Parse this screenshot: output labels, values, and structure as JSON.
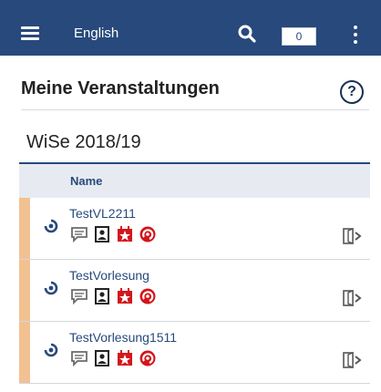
{
  "topbar": {
    "menu_icon": "hamburger-icon",
    "language_label": "English",
    "search_icon": "search-icon",
    "counter_value": "0",
    "more_icon": "more-vertical-icon",
    "background_color": "#28497c"
  },
  "page": {
    "title": "Meine Veranstaltungen",
    "help_label": "?"
  },
  "semester": {
    "label": "WiSe 2018/19"
  },
  "table": {
    "headers": {
      "name": "Name"
    },
    "rows": [
      {
        "name": "TestVL2211"
      },
      {
        "name": "TestVorlesung"
      },
      {
        "name": "TestVorlesung1511"
      }
    ]
  },
  "colors": {
    "accent": "#28497c",
    "stripe": "#f2c191",
    "tool_red": "#d3161c",
    "tool_grey": "#6b6b6b"
  }
}
